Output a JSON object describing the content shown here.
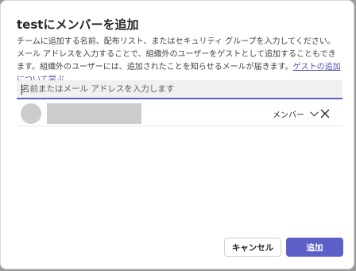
{
  "dialog": {
    "title": "testにメンバーを追加",
    "description": "チームに追加する名前、配布リスト、またはセキュリティ グループを入力してください。メール アドレスを入力することで、組織外のユーザーをゲストとして追加することもできます。組織外のユーザーには、追加されたことを知らせるメールが届きます。",
    "guest_link": "ゲストの追加について学ぶ"
  },
  "search": {
    "placeholder": "名前またはメール アドレスを入力します",
    "value": ""
  },
  "members": [
    {
      "role": "メンバー",
      "role_icon": "chevron-down-icon",
      "remove_icon": "close-icon"
    }
  ],
  "buttons": {
    "cancel": "キャンセル",
    "add": "追加"
  },
  "colors": {
    "accent": "#5b5fc7",
    "link": "#4f52b2"
  }
}
